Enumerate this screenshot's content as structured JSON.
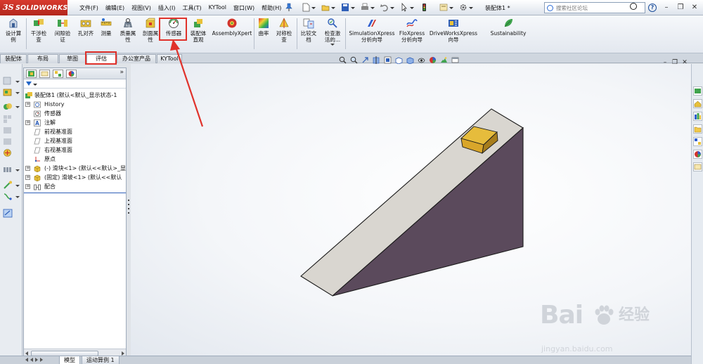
{
  "app": {
    "brand": "SOLIDWORKS",
    "brand_mark": "3S",
    "document_title": "装配体1 *"
  },
  "menu": [
    "文件(F)",
    "编辑(E)",
    "视图(V)",
    "插入(I)",
    "工具(T)",
    "KYTool",
    "窗口(W)",
    "帮助(H)"
  ],
  "search": {
    "placeholder": "搜索社区论坛"
  },
  "commands": [
    {
      "label": "设计算\n例"
    },
    {
      "label": "干涉检\n查"
    },
    {
      "label": "间隙验\n证"
    },
    {
      "label": "孔对齐"
    },
    {
      "label": "测量"
    },
    {
      "label": "质量属\n性"
    },
    {
      "label": "剖面属\n性"
    },
    {
      "label": "传感器"
    },
    {
      "label": "装配体\n直观"
    },
    {
      "label": "AssemblyXpert"
    },
    {
      "label": "曲率"
    },
    {
      "label": "对称检\n查"
    },
    {
      "label": "比较文\n档"
    },
    {
      "label": "检查激\n活的..."
    },
    {
      "label": "SimulationXpress\n分析向导"
    },
    {
      "label": "FloXpress\n分析向导"
    },
    {
      "label": "DriveWorksXpress\n向导"
    },
    {
      "label": "Sustainability"
    }
  ],
  "tabs": [
    "装配体",
    "布局",
    "草图",
    "评估",
    "办公室产品",
    "KYTool"
  ],
  "active_tab": "评估",
  "tree": [
    {
      "label": "装配体1  (默认<默认_显示状态-1",
      "level": 0,
      "expand": ""
    },
    {
      "label": "History",
      "level": 1,
      "expand": "+"
    },
    {
      "label": "传感器",
      "level": 1,
      "expand": ""
    },
    {
      "label": "注解",
      "level": 1,
      "expand": "+"
    },
    {
      "label": "前视基准面",
      "level": 1,
      "expand": ""
    },
    {
      "label": "上视基准面",
      "level": 1,
      "expand": ""
    },
    {
      "label": "右视基准面",
      "level": 1,
      "expand": ""
    },
    {
      "label": "原点",
      "level": 1,
      "expand": ""
    },
    {
      "label": "(-) 滑块<1> (默认<<默认>_显",
      "level": 1,
      "expand": "+"
    },
    {
      "label": "(固定) 滑坡<1> (默认<<默认",
      "level": 1,
      "expand": "+"
    },
    {
      "label": "配合",
      "level": 1,
      "expand": "+"
    }
  ],
  "bottom_tabs": [
    "模型",
    "运动算例 1"
  ],
  "watermark": {
    "brand": "Bai",
    "brand_end": "经验",
    "url": "jingyan.baidu.com"
  },
  "colors": {
    "brand_red": "#c8302a",
    "highlight_red": "#e0322b",
    "wedge_top": "#d9d6d0",
    "wedge_side": "#5b4a5c",
    "block": "#d6a62a"
  }
}
